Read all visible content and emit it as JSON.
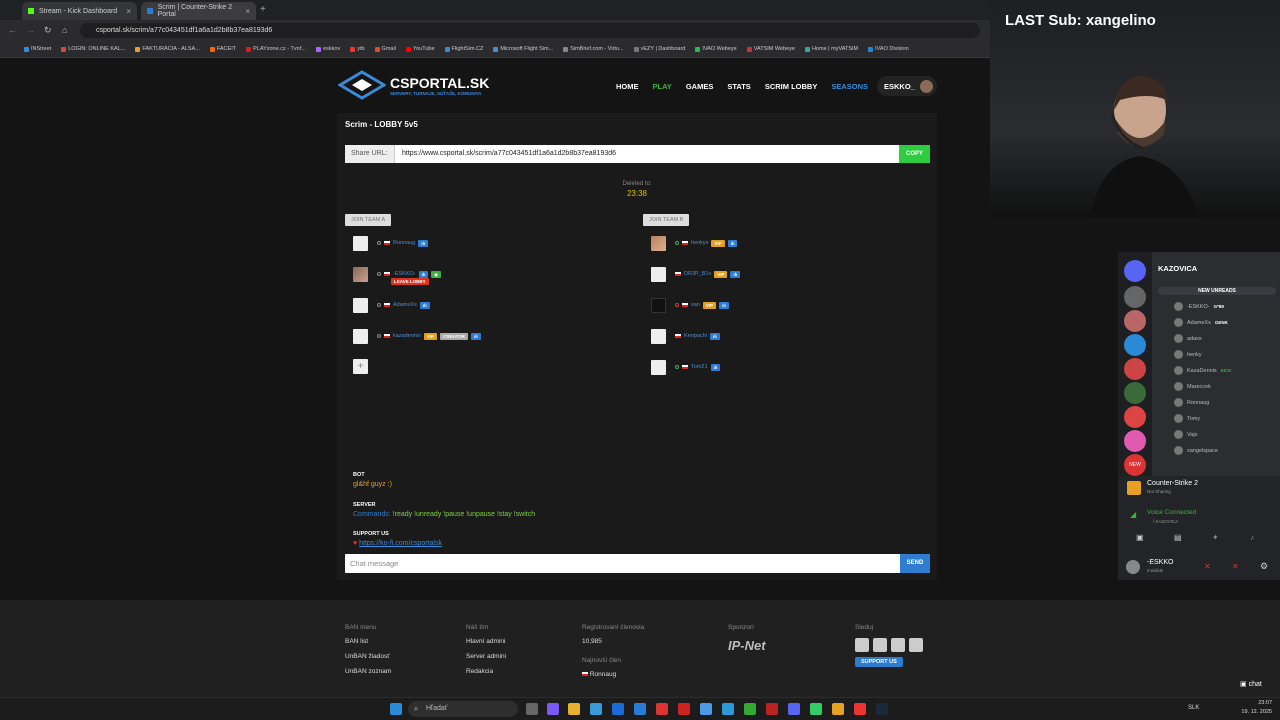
{
  "browser": {
    "tabs": [
      {
        "title": "Stream - Kick Dashboard"
      },
      {
        "title": "Scrim | Counter-Strike 2 Portal"
      }
    ],
    "url": "csportal.sk/scrim/a77c043451df1a6a1d2b8b37ea8193d6",
    "bookmarks": [
      "INStreet",
      "LOGIN: ONLINE KAL...",
      "FAKTURÁCIA - ALSA...",
      "FACEIT",
      "PLAYzone.cz - Tvoř...",
      "eskkov",
      "ytb",
      "Gmail",
      "YouTube",
      "FlightSim.CZ",
      "Microsoft Flight Sim...",
      "SimBrief.com - Virtu...",
      "vEZY | Dashboard",
      "IVAO Webeye",
      "VATSIM Webeye",
      "Home | myVATSIM",
      "IVAO Division"
    ]
  },
  "site": {
    "logo_text": "CSPORTAL.SK",
    "logo_sub": "SERVERY, TURNAJE, SÚŤAŽE, KOMUNITA",
    "nav": [
      "HOME",
      "PLAY",
      "GAMES",
      "STATS",
      "SCRIM LOBBY",
      "SEASONS"
    ],
    "user": "ESKKO_",
    "panel_title": "Scrim - LOBBY 5v5",
    "share_label": "Share URL:",
    "share_url": "https://www.csportal.sk/scrim/a77c043451df1a6a1d2b8b37ea8193d6",
    "copy_label": "COPY",
    "deleted_label": "Deleted to:",
    "deleted_time": "23:38",
    "team_a": {
      "join_label": "JOIN TEAM A",
      "players": [
        {
          "name": "Ronnaug",
          "badges": [
            "stat"
          ]
        },
        {
          "name": "-ESKKO-",
          "badges": [
            "stat",
            "green"
          ],
          "leave_label": "LEAVE LOBBY"
        },
        {
          "name": "AdameXs",
          "badges": [
            "stat"
          ]
        },
        {
          "name": "kazadennis",
          "badges": [
            "VIP",
            "CREATOR",
            "stat"
          ]
        }
      ]
    },
    "team_b": {
      "join_label": "JOIN TEAM B",
      "players": [
        {
          "name": "henkys",
          "badges": [
            "VIP",
            "stat"
          ]
        },
        {
          "name": "DR3P_B1v",
          "badges": [
            "VIP",
            "stat"
          ]
        },
        {
          "name": "xan",
          "badges": [
            "VIP",
            "stat"
          ]
        },
        {
          "name": "Kenpachi",
          "badges": [
            "stat"
          ]
        },
        {
          "name": "Tom21",
          "badges": [
            "stat"
          ]
        }
      ]
    },
    "chat": [
      {
        "who": "BOT",
        "text": "gl&hf guyz :)"
      },
      {
        "who": "SERVER",
        "prefix": "Commands:",
        "text": "!ready !unready !pause !unpause !stay !switch"
      },
      {
        "who": "SUPPORT US",
        "text": "https://ko-fi.com/csportalsk"
      }
    ],
    "chat_placeholder": "Chat message",
    "send_label": "SEND"
  },
  "footer": {
    "ban_menu": {
      "title": "BAN menu",
      "items": [
        "BAN list",
        "UnBAN žiadosť",
        "UnBAN zoznam"
      ]
    },
    "team": {
      "title": "Náš tím",
      "items": [
        "Hlavní admini",
        "Server admini",
        "Redakcia"
      ]
    },
    "registered": {
      "title": "Registrovaní členovia",
      "value": "10,985"
    },
    "newest": {
      "title": "Najnovší člen",
      "value": "Ronnaug"
    },
    "sponsors": {
      "title": "Sponzori",
      "value": "IP-Net"
    },
    "follow": {
      "title": "Sleduj",
      "support": "SUPPORT US"
    }
  },
  "overlay": {
    "last_sub": "LAST Sub: xangelino"
  },
  "discord": {
    "server_name": "KAZOVICA",
    "new_unreads": "NEW UNREADS",
    "voice_users": [
      {
        "name": "-ESKKO-",
        "tag": "G*89"
      },
      {
        "name": "AdameXs",
        "tag": "GENK"
      },
      {
        "name": "adaxs",
        "tag": ""
      },
      {
        "name": "henky",
        "tag": ""
      },
      {
        "name": "KazaDennis",
        "tag": "KICK"
      },
      {
        "name": "Mareccek",
        "tag": ""
      },
      {
        "name": "Ronnaug",
        "tag": ""
      },
      {
        "name": "Tomy",
        "tag": ""
      },
      {
        "name": "Vajo",
        "tag": ""
      },
      {
        "name": "xangelspace",
        "tag": ""
      }
    ],
    "game": "Counter-Strike 2",
    "game_status": "Not Sharing",
    "voice_status": "Voice Connected",
    "voice_channel": "/ KAZOVICA",
    "username": "-ESKKO",
    "user_status": "Invisible",
    "new_badge": "NEW"
  },
  "taskbar": {
    "search_placeholder": "Hľadať",
    "lang": "SLK",
    "time": "23:07",
    "date": "19. 12. 2025",
    "chat_label": "chat"
  }
}
